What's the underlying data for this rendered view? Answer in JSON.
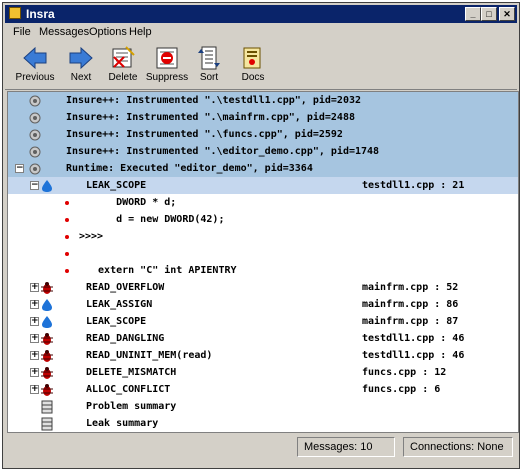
{
  "window": {
    "title": "Insra"
  },
  "menu": [
    "File",
    "Messages",
    "Options",
    "Help"
  ],
  "toolbar": [
    {
      "label": "Previous",
      "icon": "arrow-left-icon"
    },
    {
      "label": "Next",
      "icon": "arrow-right-icon"
    },
    {
      "label": "Delete",
      "icon": "delete-icon"
    },
    {
      "label": "Suppress",
      "icon": "suppress-icon"
    },
    {
      "label": "Sort",
      "icon": "sort-icon"
    },
    {
      "label": "Docs",
      "icon": "docs-icon"
    }
  ],
  "messages": [
    {
      "text": "Insure++: Instrumented \".\\testdll1.cpp\", pid=2032",
      "loc": "",
      "icon": "gear-icon"
    },
    {
      "text": "Insure++: Instrumented \".\\mainfrm.cpp\", pid=2488",
      "loc": "",
      "icon": "gear-icon"
    },
    {
      "text": "Insure++: Instrumented \".\\funcs.cpp\", pid=2592",
      "loc": "",
      "icon": "gear-icon"
    },
    {
      "text": "Insure++: Instrumented \".\\editor_demo.cpp\", pid=1748",
      "loc": "",
      "icon": "gear-icon"
    },
    {
      "text": "Runtime: Executed \"editor_demo\", pid=3364",
      "loc": "",
      "icon": "gear-icon"
    },
    {
      "text": "LEAK_SCOPE",
      "loc": "testdll1.cpp : 21",
      "icon": "leak-drop-icon"
    },
    {
      "text": "     DWORD * d;",
      "loc": "",
      "icon": "bullet"
    },
    {
      "text": "     d = new DWORD(42);",
      "loc": "",
      "icon": "bullet"
    },
    {
      "text": ">>>>",
      "loc": "",
      "icon": "bullet"
    },
    {
      "text": "",
      "loc": "",
      "icon": "bullet"
    },
    {
      "text": "  extern \"C\" int APIENTRY",
      "loc": "",
      "icon": "bullet"
    },
    {
      "text": "READ_OVERFLOW",
      "loc": "mainfrm.cpp : 52",
      "icon": "bug-icon"
    },
    {
      "text": "LEAK_ASSIGN",
      "loc": "mainfrm.cpp : 86",
      "icon": "leak-drop-icon"
    },
    {
      "text": "LEAK_SCOPE",
      "loc": "mainfrm.cpp : 87",
      "icon": "leak-drop-icon"
    },
    {
      "text": "READ_DANGLING",
      "loc": "testdll1.cpp : 46",
      "icon": "bug-icon"
    },
    {
      "text": "READ_UNINIT_MEM(read)",
      "loc": "testdll1.cpp : 46",
      "icon": "bug-icon"
    },
    {
      "text": "DELETE_MISMATCH",
      "loc": "funcs.cpp : 12",
      "icon": "bug-icon"
    },
    {
      "text": "ALLOC_CONFLICT",
      "loc": "funcs.cpp : 6",
      "icon": "bug-icon"
    },
    {
      "text": "Problem summary",
      "loc": "",
      "icon": "summary-icon"
    },
    {
      "text": "Leak summary",
      "loc": "",
      "icon": "summary-icon"
    }
  ],
  "status": {
    "messages": "Messages: 10",
    "connections": "Connections: None"
  }
}
